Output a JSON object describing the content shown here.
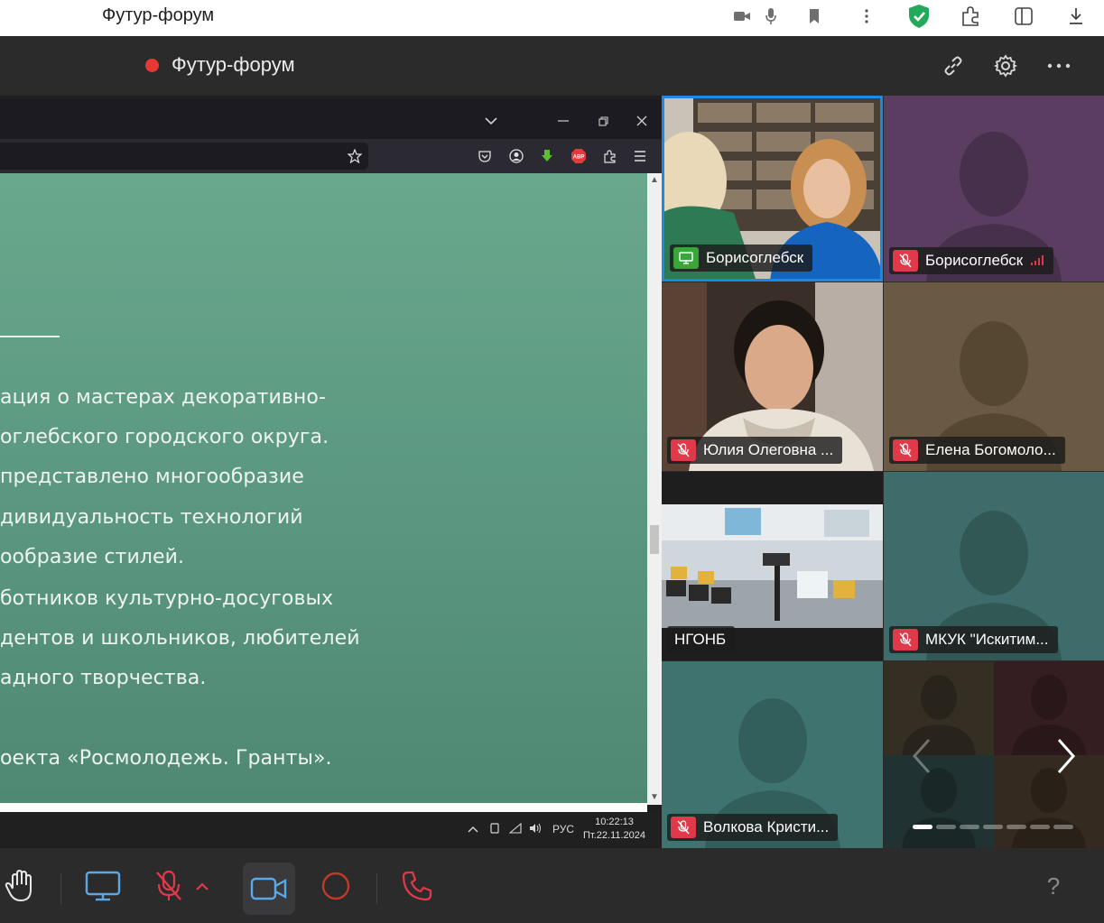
{
  "browser": {
    "title": "Футур-форум"
  },
  "meeting": {
    "title": "Футур-форум"
  },
  "slide": {
    "lines": [
      "ация о мастерах декоративно-",
      "оглебского городского округа.",
      " представлено многообразие",
      "дивидуальность технологий",
      "ообразие стилей.",
      "ботников культурно-досуговых",
      "дентов и школьников, любителей",
      "адного творчества.",
      "оекта «Росмолодежь. Гранты»."
    ]
  },
  "taskbar": {
    "lang": "РУС",
    "time": "10:22:13",
    "date": "Пт.22.11.2024"
  },
  "participants": [
    {
      "name": "Борисоглебск",
      "status": "screen-share",
      "active": true
    },
    {
      "name": "Борисоглебск",
      "status": "muted",
      "bg": "#5a3d61"
    },
    {
      "name": "Юлия Олеговна ...",
      "status": "muted"
    },
    {
      "name": "Елена Богомоло...",
      "status": "muted",
      "bg": "#6b5a43"
    },
    {
      "name": "НГОНБ",
      "status": "none"
    },
    {
      "name": "МКУК \"Искитим...",
      "status": "muted",
      "bg": "#3e6c6a"
    },
    {
      "name": "Волкова Кристи...",
      "status": "muted",
      "bg": "#3f7370"
    }
  ],
  "pager": {
    "pages": 7,
    "current": 1
  },
  "colors": {
    "mute_red": "#e0394a",
    "accent_blue": "#1e88e5",
    "rec_red": "#e53935"
  },
  "controls": {
    "help": "?"
  }
}
